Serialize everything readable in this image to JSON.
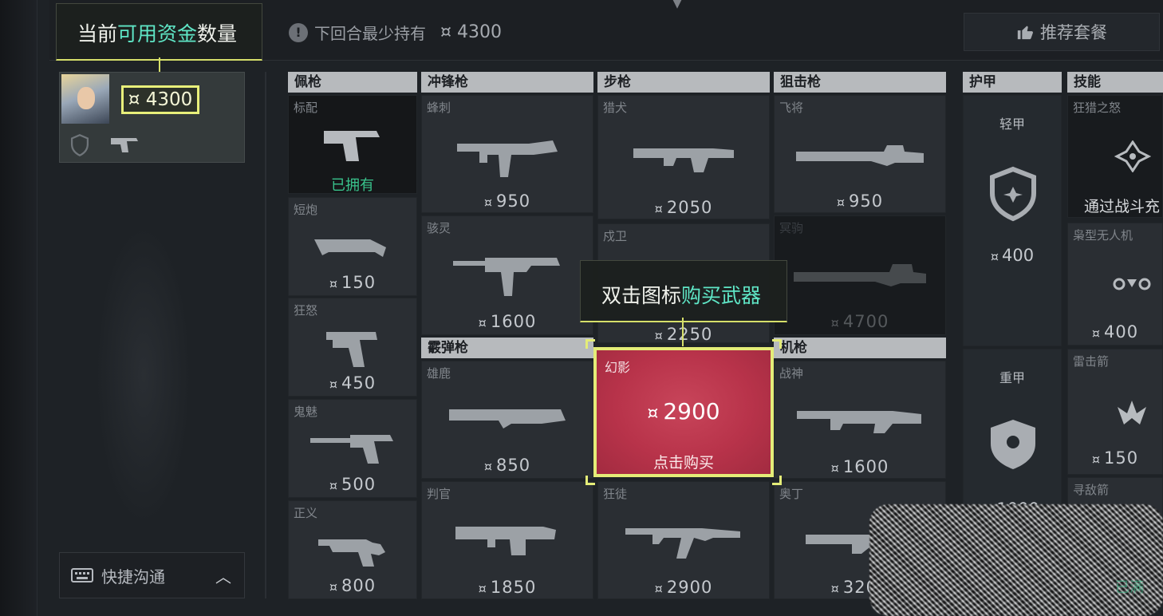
{
  "top": {
    "funds_tip_prefix": "当前",
    "funds_tip_highlight": "可用资金",
    "funds_tip_suffix": "数量",
    "min_hold_label": "下回合最少持有",
    "min_hold_value": "¤ 4300",
    "recommend_label": "推荐套餐"
  },
  "player": {
    "credits": "¤ 4300"
  },
  "chat": {
    "label": "快捷沟通"
  },
  "columns": {
    "sidearms": "佩枪",
    "smgs": "冲锋枪",
    "rifles": "步枪",
    "snipers": "狙击枪",
    "shotguns": "霰弹枪",
    "mgs": "机枪",
    "armor": "护甲",
    "abilities": "技能"
  },
  "sidearms": [
    {
      "name": "标配",
      "status": "已拥有"
    },
    {
      "name": "短炮",
      "price": "150"
    },
    {
      "name": "狂怒",
      "price": "450"
    },
    {
      "name": "鬼魅",
      "price": "500"
    },
    {
      "name": "正义",
      "price": "800"
    }
  ],
  "smgs": [
    {
      "name": "蜂刺",
      "price": "950"
    },
    {
      "name": "骇灵",
      "price": "1600"
    }
  ],
  "shotguns": [
    {
      "name": "雄鹿",
      "price": "850"
    },
    {
      "name": "判官",
      "price": "1850"
    }
  ],
  "rifles": [
    {
      "name": "猎犬",
      "price": "2050"
    },
    {
      "name": "戍卫",
      "price": "2250"
    },
    {
      "name": "幻影",
      "price": "2900",
      "action": "点击购买"
    },
    {
      "name": "狂徒",
      "price": "2900"
    }
  ],
  "snipers": [
    {
      "name": "飞将",
      "price": "950"
    },
    {
      "name": "冥驹",
      "price": "4700"
    }
  ],
  "mgs": [
    {
      "name": "战神",
      "price": "1600"
    },
    {
      "name": "奥丁",
      "price": "3200"
    }
  ],
  "armor": [
    {
      "name": "轻甲",
      "price": "400"
    },
    {
      "name": "重甲",
      "price": "1000"
    }
  ],
  "abilities": [
    {
      "name": "狂猎之怒",
      "note": "通过战斗充"
    },
    {
      "name": "枭型无人机",
      "price": "400"
    },
    {
      "name": "雷击箭",
      "price": "150"
    },
    {
      "name": "寻敌箭"
    }
  ],
  "buy_tip": {
    "prefix": "双击图标",
    "highlight": "购买武器"
  },
  "noise_owned": "已满",
  "currency_symbol": "¤"
}
